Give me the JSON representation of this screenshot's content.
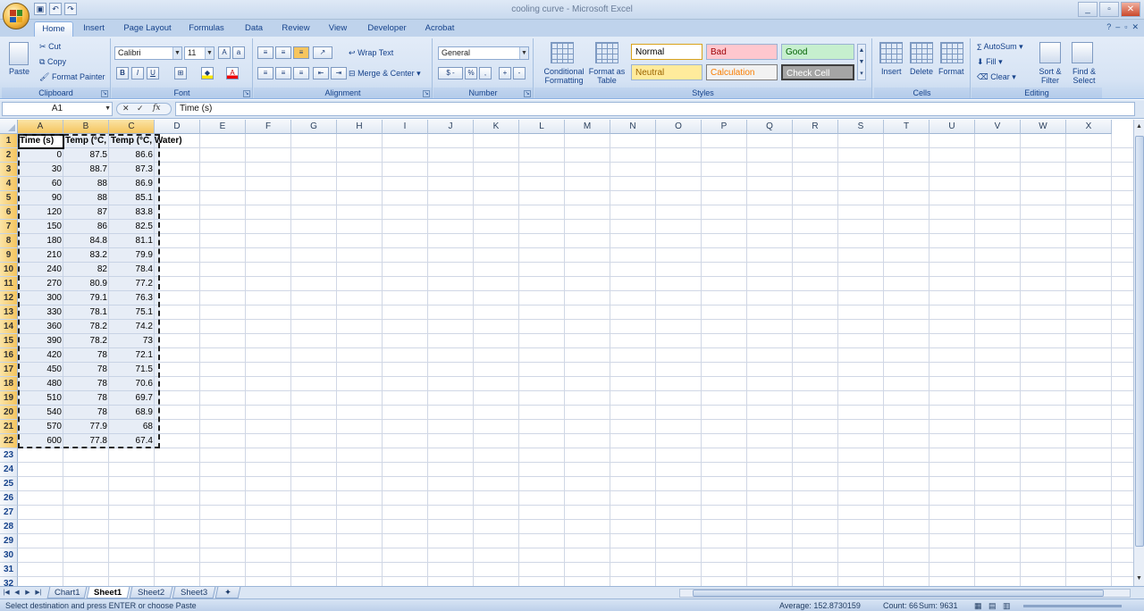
{
  "window": {
    "title": "cooling curve - Microsoft Excel",
    "quick_access": [
      "save-icon",
      "undo-icon",
      "redo-icon"
    ],
    "controls": [
      "_",
      "▫",
      "✕"
    ]
  },
  "ribbon_tabs": [
    "Home",
    "Insert",
    "Page Layout",
    "Formulas",
    "Data",
    "Review",
    "View",
    "Developer",
    "Acrobat"
  ],
  "clipboard": {
    "label": "Clipboard",
    "paste": "Paste",
    "cut": "Cut",
    "copy": "Copy",
    "format_painter": "Format Painter"
  },
  "font": {
    "label": "Font",
    "name": "Calibri",
    "size": "11",
    "bold": "B",
    "italic": "I",
    "underline": "U"
  },
  "alignment": {
    "label": "Alignment",
    "wrap_text": "Wrap Text",
    "merge_center": "Merge & Center"
  },
  "number": {
    "label": "Number",
    "format": "General",
    "currency": "$ -",
    "percent": "%",
    "comma": ","
  },
  "styles": {
    "label": "Styles",
    "conditional": "Conditional Formatting",
    "format_table": "Format as Table",
    "normal": "Normal",
    "bad": "Bad",
    "good": "Good",
    "neutral": "Neutral",
    "calculation": "Calculation",
    "check_cell": "Check Cell"
  },
  "cells_group": {
    "label": "Cells",
    "insert": "Insert",
    "delete": "Delete",
    "format": "Format"
  },
  "editing": {
    "label": "Editing",
    "autosum": "AutoSum",
    "fill": "Fill",
    "clear": "Clear",
    "sort_filter": "Sort & Filter",
    "find_select": "Find & Select"
  },
  "formula_bar": {
    "name_box": "A1",
    "formula": "Time (s)"
  },
  "columns": [
    "A",
    "B",
    "C",
    "D",
    "E",
    "F",
    "G",
    "H",
    "I",
    "J",
    "K",
    "L",
    "M",
    "N",
    "O",
    "P",
    "Q",
    "R",
    "S",
    "T",
    "U",
    "V",
    "W",
    "X"
  ],
  "rows": [
    "1",
    "2",
    "3",
    "4",
    "5",
    "6",
    "7",
    "8",
    "9",
    "10",
    "11",
    "12",
    "13",
    "14",
    "15",
    "16",
    "17",
    "18",
    "19",
    "20",
    "21",
    "22",
    "23",
    "24",
    "25",
    "26",
    "27",
    "28",
    "29",
    "30",
    "31",
    "32"
  ],
  "table": {
    "headers": [
      "Time (s)",
      "Temp (°C,",
      "Temp (°C, Water)"
    ],
    "data": [
      [
        "0",
        "87.5",
        "86.6"
      ],
      [
        "30",
        "88.7",
        "87.3"
      ],
      [
        "60",
        "88",
        "86.9"
      ],
      [
        "90",
        "88",
        "85.1"
      ],
      [
        "120",
        "87",
        "83.8"
      ],
      [
        "150",
        "86",
        "82.5"
      ],
      [
        "180",
        "84.8",
        "81.1"
      ],
      [
        "210",
        "83.2",
        "79.9"
      ],
      [
        "240",
        "82",
        "78.4"
      ],
      [
        "270",
        "80.9",
        "77.2"
      ],
      [
        "300",
        "79.1",
        "76.3"
      ],
      [
        "330",
        "78.1",
        "75.1"
      ],
      [
        "360",
        "78.2",
        "74.2"
      ],
      [
        "390",
        "78.2",
        "73"
      ],
      [
        "420",
        "78",
        "72.1"
      ],
      [
        "450",
        "78",
        "71.5"
      ],
      [
        "480",
        "78",
        "70.6"
      ],
      [
        "510",
        "78",
        "69.7"
      ],
      [
        "540",
        "78",
        "68.9"
      ],
      [
        "570",
        "77.9",
        "68"
      ],
      [
        "600",
        "77.8",
        "67.4"
      ]
    ]
  },
  "sheet_tabs": [
    "Chart1",
    "Sheet1",
    "Sheet2",
    "Sheet3"
  ],
  "active_sheet": "Sheet1",
  "status": {
    "message": "Select destination and press ENTER or choose Paste",
    "average": "Average: 152.8730159",
    "count": "Count: 66",
    "sum": "Sum: 9631"
  }
}
